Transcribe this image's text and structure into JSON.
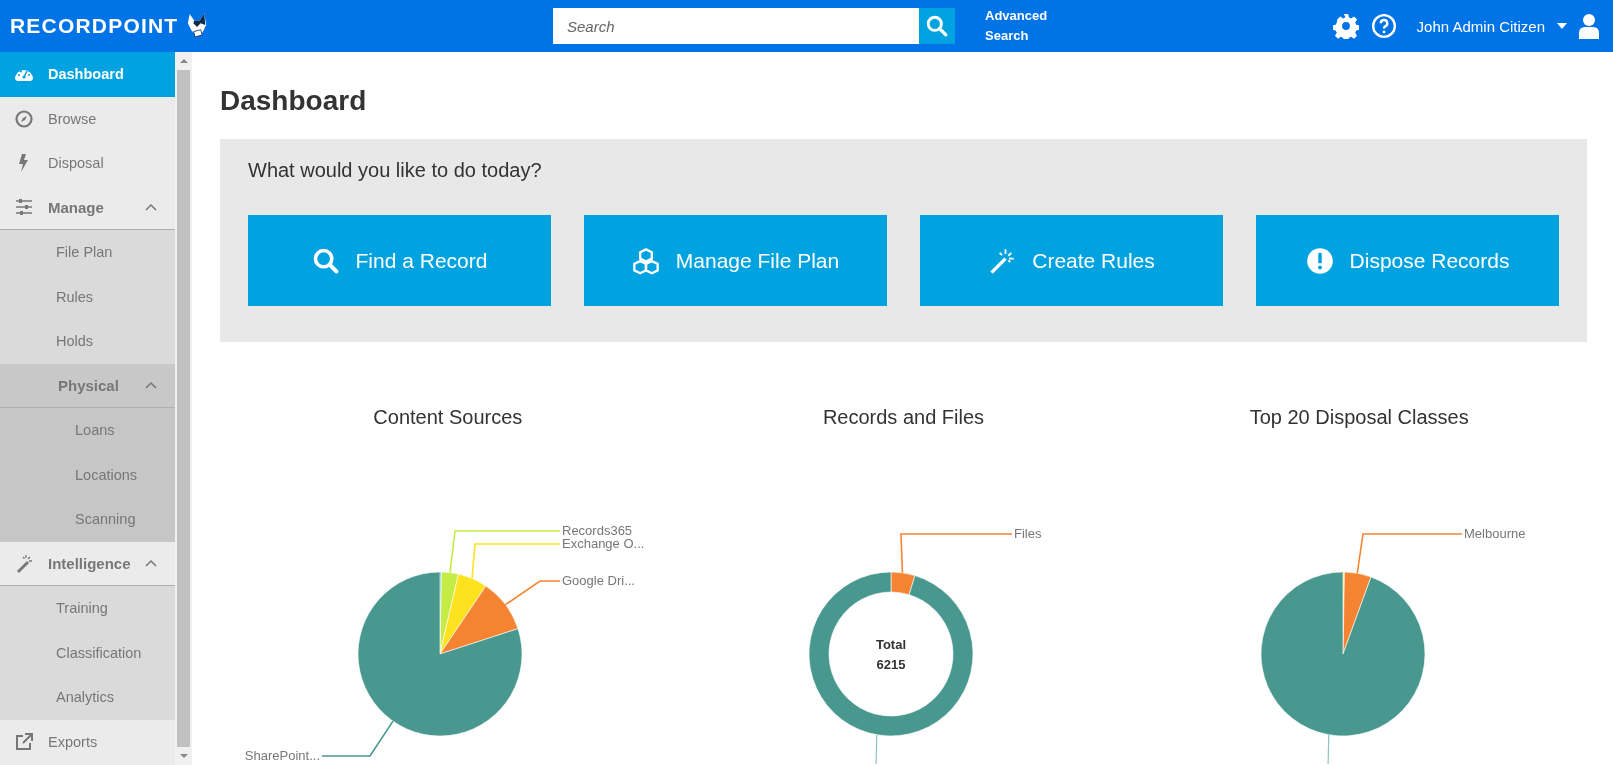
{
  "header": {
    "logo": "RECORDPOINT",
    "search": {
      "placeholder": "Search"
    },
    "advanced_search": "Advanced Search",
    "user": "John Admin Citizen"
  },
  "sidebar": {
    "items": [
      {
        "label": "Dashboard",
        "selected": true
      },
      {
        "label": "Browse",
        "selected": false
      },
      {
        "label": "Disposal",
        "selected": false
      },
      {
        "label": "Manage",
        "selected": false,
        "expanded": true,
        "children": [
          {
            "label": "File Plan",
            "selected": false
          },
          {
            "label": "Rules",
            "selected": false
          },
          {
            "label": "Holds",
            "selected": false
          },
          {
            "label": "Physical",
            "selected": false,
            "expanded": true,
            "children": [
              {
                "label": "Loans",
                "selected": false
              },
              {
                "label": "Locations",
                "selected": false
              },
              {
                "label": "Scanning",
                "selected": false
              }
            ]
          }
        ]
      },
      {
        "label": "Intelligence",
        "selected": false,
        "expanded": true,
        "children": [
          {
            "label": "Training",
            "selected": false
          },
          {
            "label": "Classification",
            "selected": false
          },
          {
            "label": "Analytics",
            "selected": false
          }
        ]
      },
      {
        "label": "Exports",
        "selected": false
      }
    ]
  },
  "page_title": "Dashboard",
  "quick_actions": {
    "prompt": "What would you like to do today?",
    "buttons": [
      "Find a Record",
      "Manage File Plan",
      "Create Rules",
      "Dispose Records"
    ]
  },
  "charts": [
    {
      "title": "Content Sources",
      "kind": "pie",
      "slice_labels": [
        {
          "text": "Records365",
          "color": "#c5ec45"
        },
        {
          "text": "Exchange O...",
          "color": "#fde21f"
        },
        {
          "text": "Google Dri...",
          "color": "#f58432"
        },
        {
          "text": "SharePoint...",
          "color": "#48988f"
        }
      ]
    },
    {
      "title": "Records and Files",
      "kind": "donut",
      "center_label": "Total",
      "center_value": "6215",
      "slice_labels": [
        {
          "text": "Files",
          "color": "#f58432"
        }
      ]
    },
    {
      "title": "Top 20 Disposal Classes",
      "kind": "pie",
      "slice_labels": [
        {
          "text": "Melbourne",
          "color": "#f58432"
        }
      ]
    }
  ]
}
